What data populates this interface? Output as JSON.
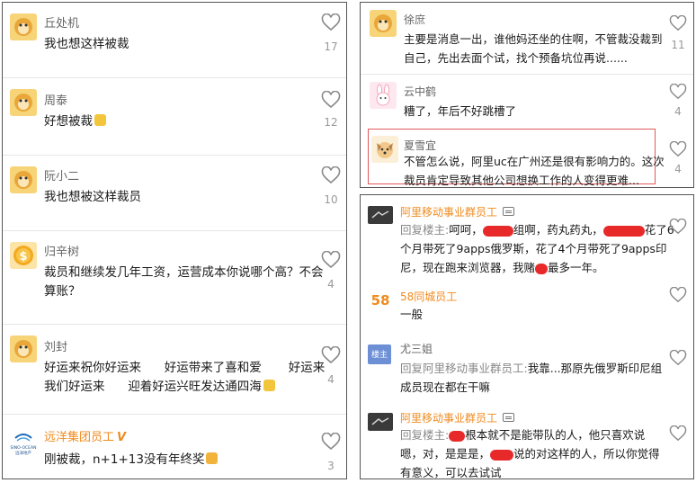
{
  "left": {
    "comments": [
      {
        "user": "丘处机",
        "text": "我也想这样被裁",
        "likes": "17"
      },
      {
        "user": "周泰",
        "text": "好想被裁",
        "likes": "12"
      },
      {
        "user": "阮小二",
        "text": "我也想被这样裁员",
        "likes": "10"
      },
      {
        "user": "归辛树",
        "text_l1": "裁员和继续发几年工资，运营成本你说哪个高？不会",
        "text_l2": "算账？",
        "likes": "4"
      },
      {
        "user": "刘封",
        "text_l1": "好运来祝你好运来      好运带来了喜和爱       好运来",
        "text_l2": "我们好运来      迎着好运兴旺发达通四海",
        "likes": "4"
      },
      {
        "user": "远洋集团员工",
        "verified": "V",
        "text": "刚被裁，n+1+13没有年终奖",
        "likes": "3",
        "logo_text_1": "SINO-OCEAN",
        "logo_text_2": "远洋地产"
      }
    ]
  },
  "right_top": {
    "comments": [
      {
        "user": "徐庶",
        "text_l1": "主要是消息一出，谁他妈还坐的住啊，不管裁没裁到",
        "text_l2": "自己，先出去面个试，找个预备坑位再说......",
        "likes": "11"
      },
      {
        "user": "云中鹤",
        "text": "糟了，年后不好跳槽了",
        "likes": "4"
      },
      {
        "user": "夏雪宜",
        "text_l1": "不管怎么说，阿里uc在广州还是很有影响力的。这次",
        "text_l2": "裁员肯定导致其他公司想换工作的人变得更难...",
        "likes": "4"
      }
    ]
  },
  "right_bottom": {
    "comments": [
      {
        "user": "阿里移动事业群员工",
        "reply_prefix": "回复楼主:",
        "t1a": "呵呵，",
        "t1b": "组啊，药丸药丸，",
        "t1c": "花了6",
        "text_l2": "个月带死了9apps俄罗斯，花了4个月带死了9apps印",
        "t3a": "尼，现在跑来浏览器，我赌",
        "t3b": "最多一年。"
      },
      {
        "user": "58同城员工",
        "text": "一般",
        "logo_text": "58"
      },
      {
        "user": "尤三姐",
        "reply_prefix": "回复阿里移动事业群员工:",
        "t1": "我靠...那原先俄罗斯印尼组",
        "text_l2": "成员现在都在干嘛",
        "avatar_label": "楼主"
      },
      {
        "user": "阿里移动事业群员工",
        "reply_prefix": "回复楼主:",
        "t1b": "根本就不是能带队的人，他只喜欢说",
        "t2a": "嗯，对，是是是，",
        "t2b": "说的对这样的人，所以你觉得",
        "text_l3": "有意义，可以去试试"
      }
    ]
  }
}
